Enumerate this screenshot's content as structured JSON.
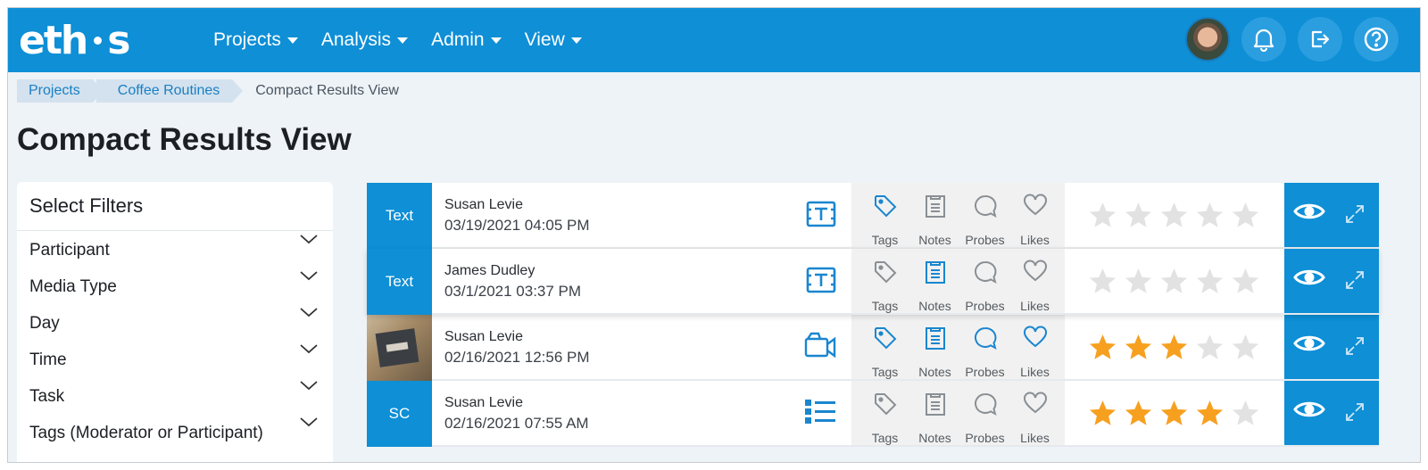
{
  "app": {
    "logo_text": "eth",
    "logo_text_end": "s",
    "nav": [
      {
        "label": "Projects"
      },
      {
        "label": "Analysis"
      },
      {
        "label": "Admin"
      },
      {
        "label": "View"
      }
    ],
    "icons": [
      "avatar",
      "bell-icon",
      "logout-icon",
      "help-icon"
    ]
  },
  "breadcrumb": [
    "Projects",
    "Coffee Routines",
    "Compact Results View"
  ],
  "page_title": "Compact Results View",
  "filters": {
    "title": "Select Filters",
    "items": [
      "Participant",
      "Media Type",
      "Day",
      "Time",
      "Task",
      "Tags (Moderator or Participant)"
    ]
  },
  "action_labels": {
    "tags": "Tags",
    "notes": "Notes",
    "probes": "Probes",
    "likes": "Likes"
  },
  "colors": {
    "accent": "#0e8fd6",
    "star_on": "#f7a020",
    "star_off": "#e2e2e2",
    "active_icon": "#1a86cf",
    "inactive_icon": "#8a8f94"
  },
  "rows": [
    {
      "thumb": "Text",
      "name": "Susan Levie",
      "date": "03/19/2021 04:05 PM",
      "media": "text-icon",
      "active": {
        "tags": true,
        "notes": false,
        "probes": false,
        "likes": false
      },
      "rating": 0
    },
    {
      "thumb": "Text",
      "name": "James Dudley",
      "date": "03/1/2021 03:37 PM",
      "media": "text-icon",
      "active": {
        "tags": false,
        "notes": true,
        "probes": false,
        "likes": false
      },
      "rating": 0
    },
    {
      "thumb": "",
      "name": "Susan Levie",
      "date": "02/16/2021 12:56 PM",
      "media": "video-icon",
      "active": {
        "tags": true,
        "notes": true,
        "probes": true,
        "likes": true
      },
      "rating": 3
    },
    {
      "thumb": "SC",
      "name": "Susan Levie",
      "date": "02/16/2021 07:55 AM",
      "media": "list-icon",
      "active": {
        "tags": false,
        "notes": false,
        "probes": false,
        "likes": false
      },
      "rating": 4
    }
  ]
}
